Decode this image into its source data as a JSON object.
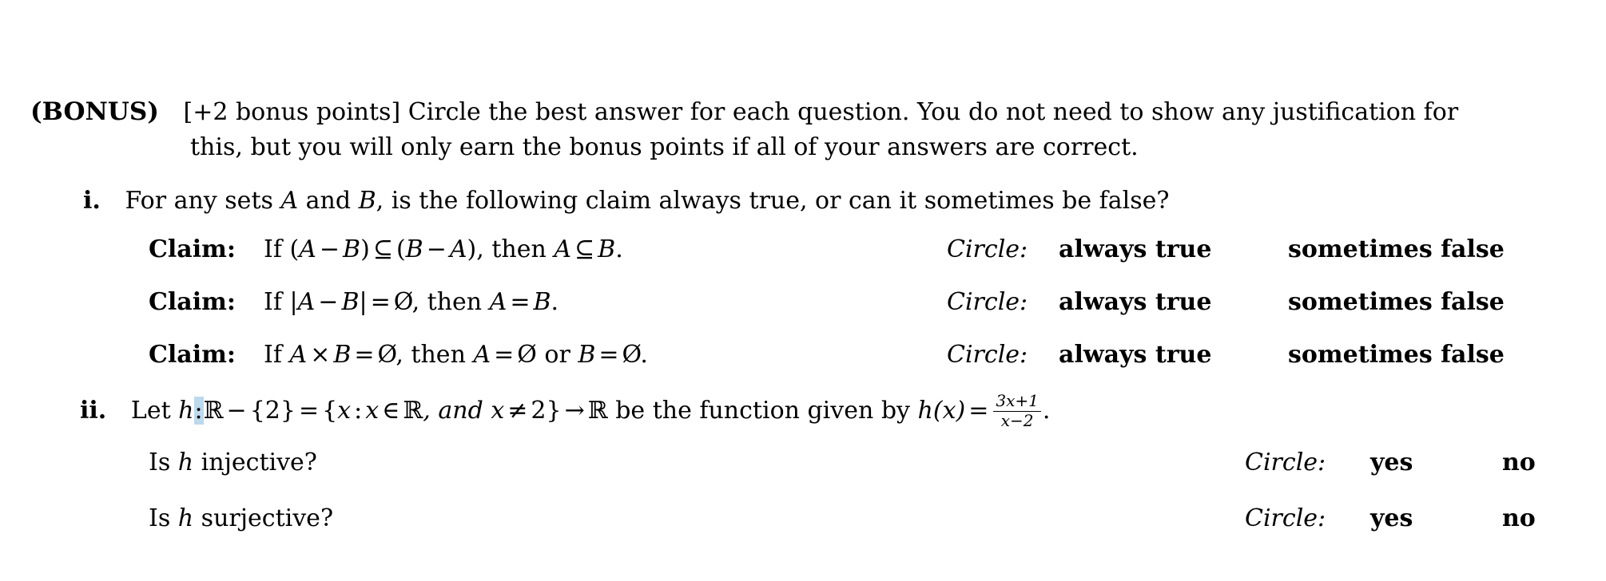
{
  "document": {
    "bonus": {
      "tag": "(BONUS)",
      "line1": "[+2 bonus points] Circle the best answer for each question. You do not need to show any justification for",
      "line2": "this, but you will only earn the bonus points if all of your answers are correct."
    },
    "item_i": {
      "number": "i.",
      "text_before_a": "For any sets",
      "var_a": "A",
      "text_between": "and",
      "var_b": "B",
      "text_after": ", is the following claim always true, or can it sometimes be false?"
    },
    "claims": [
      {
        "label": "Claim:",
        "statement": "If (A − B) ⊆ (B − A), then A ⊆ B.",
        "parts": {
          "if": "If",
          "open1": "(",
          "a1": "A",
          "minus1": "−",
          "b1": "B",
          "close1": ")",
          "subset1": "⊆",
          "open2": "(",
          "b2": "B",
          "minus2": "−",
          "a2": "A",
          "close2": ")",
          "comma": ", then",
          "a3": "A",
          "subset2": "⊆",
          "b3": "B",
          "period": "."
        },
        "circle_label": "Circle:",
        "answer_a": "always true",
        "answer_b": "sometimes false"
      },
      {
        "label": "Claim:",
        "statement": "If |A − B| = Ø, then A = B.",
        "parts": {
          "if": "If",
          "bar1": "|",
          "a1": "A",
          "minus1": "−",
          "b1": "B",
          "bar2": "|",
          "eq1": "=",
          "empty1": "Ø",
          "comma": ", then",
          "a2": "A",
          "eq2": "=",
          "b2": "B",
          "period": "."
        },
        "circle_label": "Circle:",
        "answer_a": "always true",
        "answer_b": "sometimes false"
      },
      {
        "label": "Claim:",
        "statement": "If A × B = Ø, then A = Ø or B = Ø.",
        "parts": {
          "if": "If",
          "a1": "A",
          "times": "×",
          "b1": "B",
          "eq1": "=",
          "empty1": "Ø",
          "comma": ", then",
          "a2": "A",
          "eq2": "=",
          "empty2": "Ø",
          "or": "or",
          "b2": "B",
          "eq3": "=",
          "empty3": "Ø",
          "period": "."
        },
        "circle_label": "Circle:",
        "answer_a": "always true",
        "answer_b": "sometimes false"
      }
    ],
    "item_ii": {
      "number": "ii.",
      "let": "Let",
      "h": "h",
      "colon": ":",
      "reals1": "R",
      "minus": "−",
      "set_excluded": "{2}",
      "equals": "=",
      "brace_open": "{",
      "x1": "x",
      "sep_colon": ":",
      "x2": "x",
      "elem": "∈",
      "reals2": "R",
      "comma_and": ", and",
      "x3": "x",
      "neq": "≠",
      "two": "2",
      "brace_close": "}",
      "arrow": "→",
      "reals3": "R",
      "tail": "be the function given by",
      "h_of_x": "h(x)",
      "equals2": "=",
      "fraction": {
        "numerator": "3x+1",
        "denominator": "x−2"
      },
      "period": "."
    },
    "questions": [
      {
        "prefix": "Is",
        "var": "h",
        "suffix": "injective?",
        "circle_label": "Circle:",
        "answer_yes": "yes",
        "answer_no": "no"
      },
      {
        "prefix": "Is",
        "var": "h",
        "suffix": "surjective?",
        "circle_label": "Circle:",
        "answer_yes": "yes",
        "answer_no": "no"
      }
    ],
    "colors": {
      "text": "#000000",
      "background": "#ffffff",
      "colon_highlight": "#bcd9ee"
    }
  }
}
